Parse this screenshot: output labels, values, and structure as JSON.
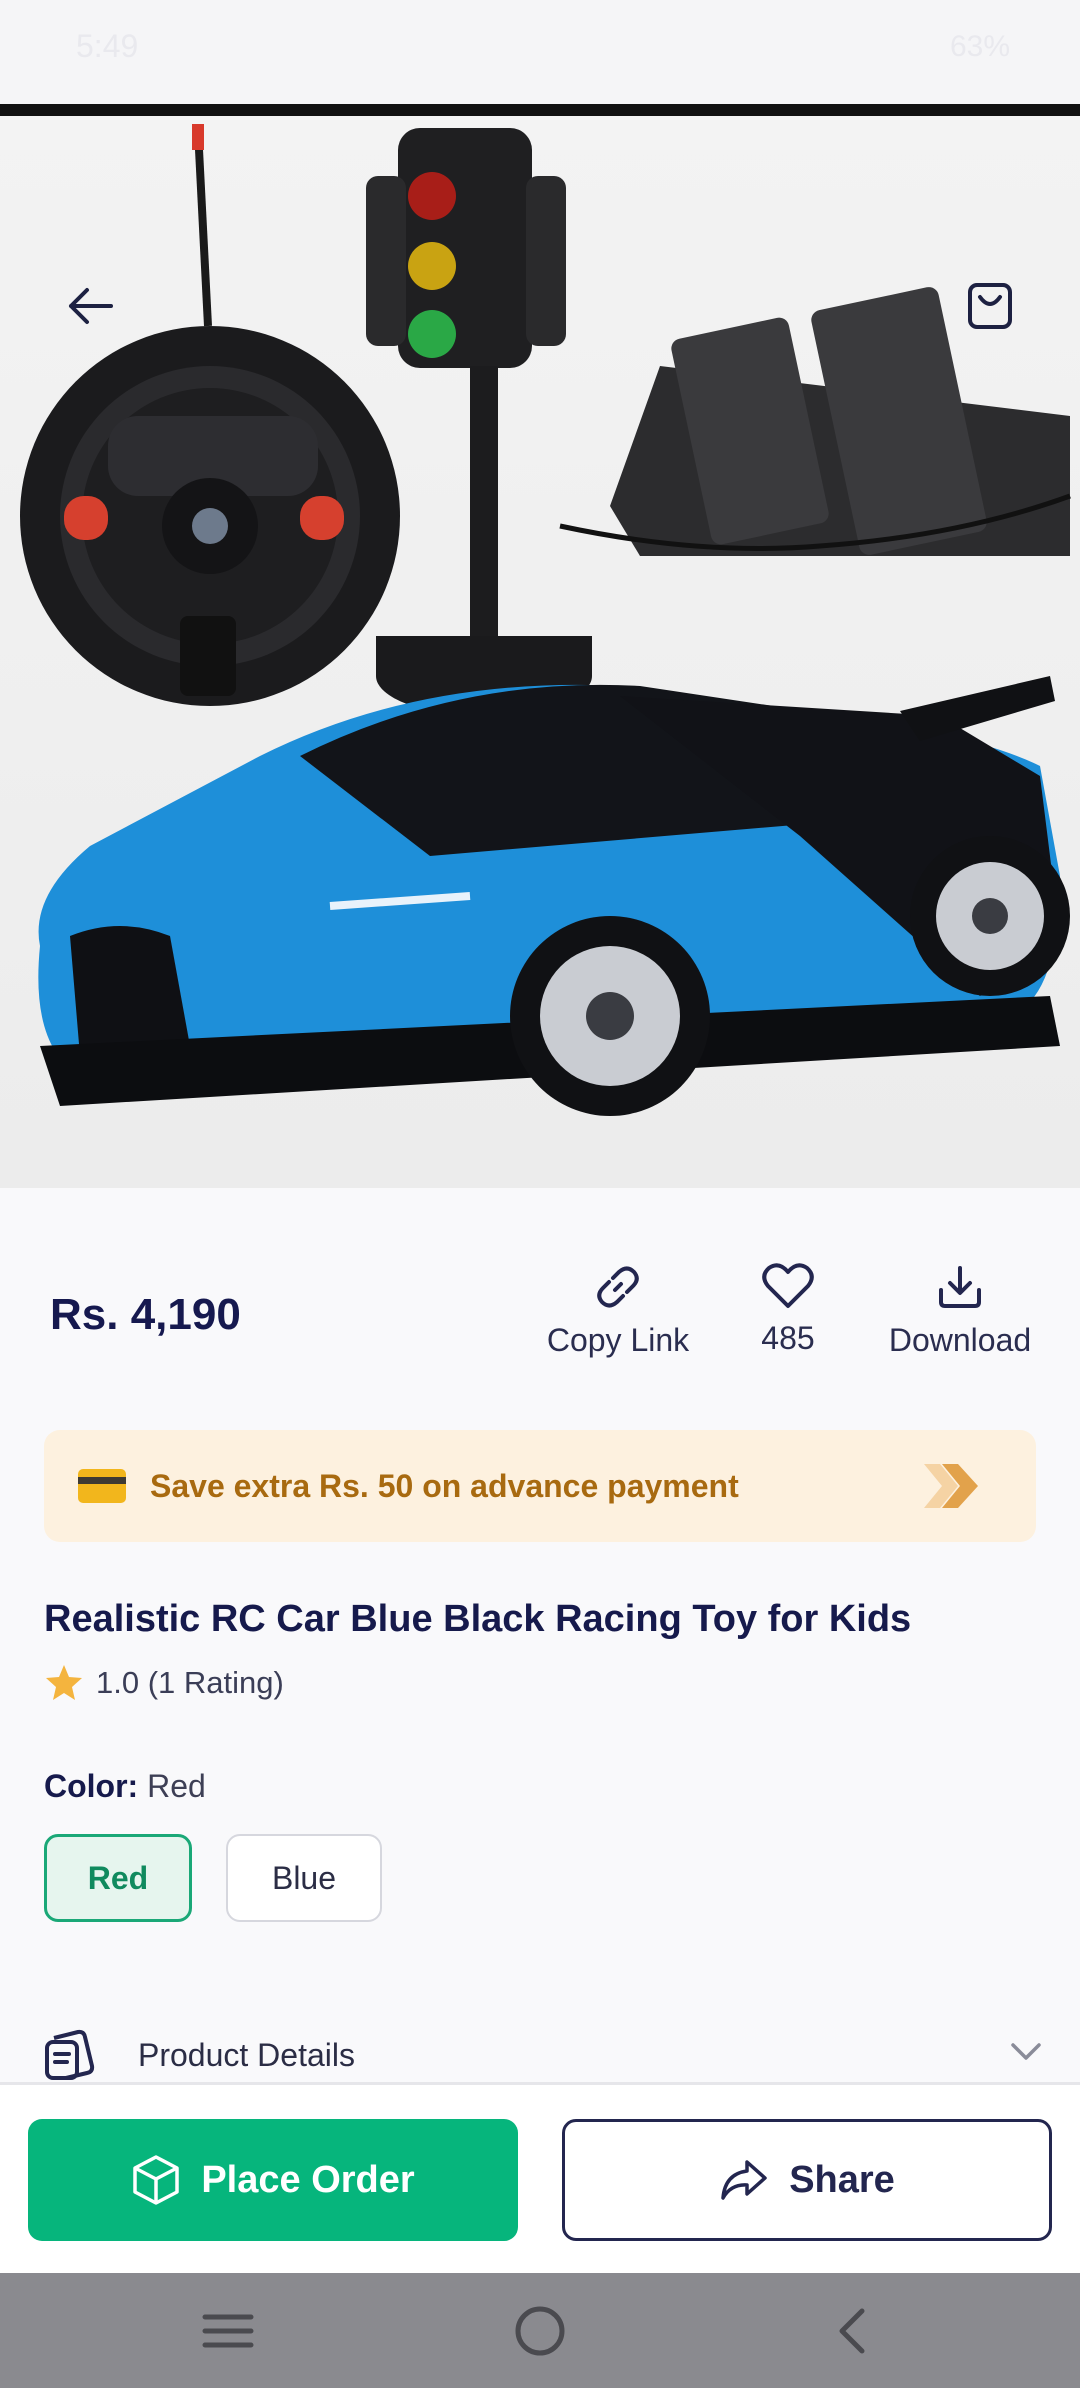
{
  "status_bar": {
    "time": "5:49",
    "battery": "63%"
  },
  "header": {
    "back_icon": "arrow-left-icon",
    "cart_icon": "shopping-bag-icon"
  },
  "gallery": {
    "total_images": 5,
    "active_index": 0
  },
  "product": {
    "price": "Rs. 4,190",
    "title": "Realistic RC Car Blue Black Racing Toy for Kids",
    "rating_text": "1.0 (1 Rating)",
    "rating_value": 1.0
  },
  "actions": {
    "copy_link_label": "Copy Link",
    "wishlist_count": "485",
    "download_label": "Download"
  },
  "promo": {
    "text": "Save extra Rs. 50 on advance payment"
  },
  "color": {
    "label": "Color:",
    "selected": "Red",
    "options": [
      "Red",
      "Blue"
    ]
  },
  "details": {
    "label": "Product Details"
  },
  "bottom_bar": {
    "order_label": "Place Order",
    "share_label": "Share"
  },
  "colors": {
    "primary_green": "#06b57c",
    "navy": "#16194f",
    "promo_bg": "#fdf1df",
    "promo_text": "#a86a10"
  }
}
